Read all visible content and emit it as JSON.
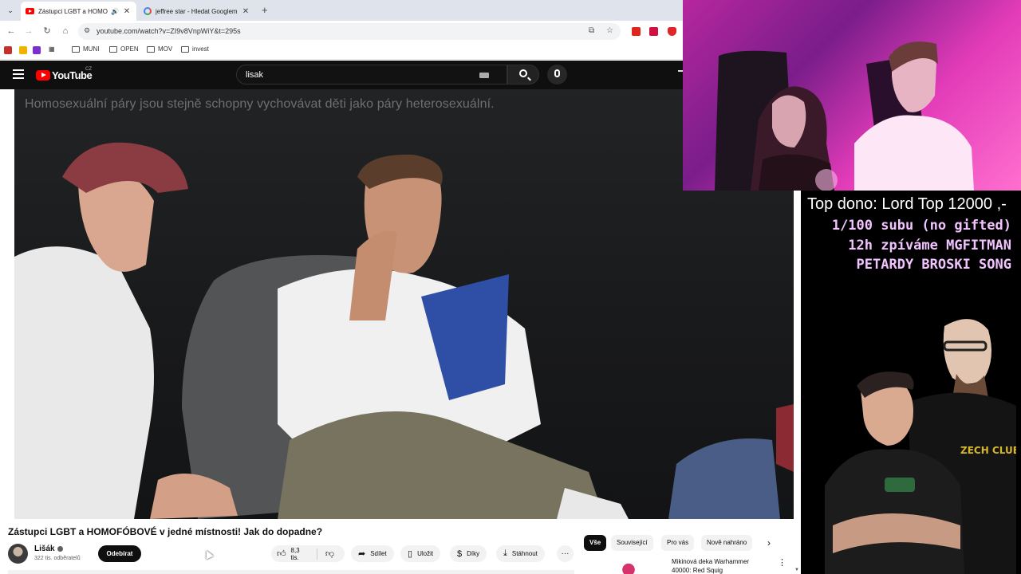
{
  "browser": {
    "tabs": [
      {
        "title": "Zástupci LGBT a HOMOFÓB",
        "active": true
      },
      {
        "title": "jeffree star - Hledat Googlem",
        "active": false
      }
    ],
    "url": "youtube.com/watch?v=ZI9v8VnpWiY&t=295s",
    "bookmarks": [
      "MUNI",
      "OPEN",
      "MOV",
      "invest"
    ]
  },
  "youtube": {
    "country_code": "CZ",
    "logo_text": "YouTube",
    "search_value": "lisak",
    "video": {
      "caption": "Homosexuální páry jsou stejně schopny vychovávat děti jako páry heterosexuální.",
      "title": "Zástupci LGBT a HOMOFÓBOVÉ v jedné místnosti! Jak do dopadne?"
    },
    "channel": {
      "name": "Lišák",
      "subscribers": "322 tis. odběratelů",
      "subscribe_label": "Odebírat"
    },
    "actions": {
      "likes": "8,3 tis.",
      "share": "Sdílet",
      "save": "Uložit",
      "thanks": "Díky",
      "download": "Stáhnout"
    },
    "chips": [
      "Vše",
      "Související",
      "Pro vás",
      "Nově nahráno"
    ],
    "recommendation": {
      "title_line1": "Mikinová deka Warhammer",
      "title_line2": "40000: Red Squig"
    }
  },
  "overlay": {
    "top_donor": "Top dono: Lord Top 12000 ,-",
    "goals": [
      "1/100 subu (no gifted)",
      "12h zpíváme MGFITMAN",
      "PETARDY BROSKI SONG"
    ],
    "promo_shirt_text": "ZECH CLUB"
  }
}
